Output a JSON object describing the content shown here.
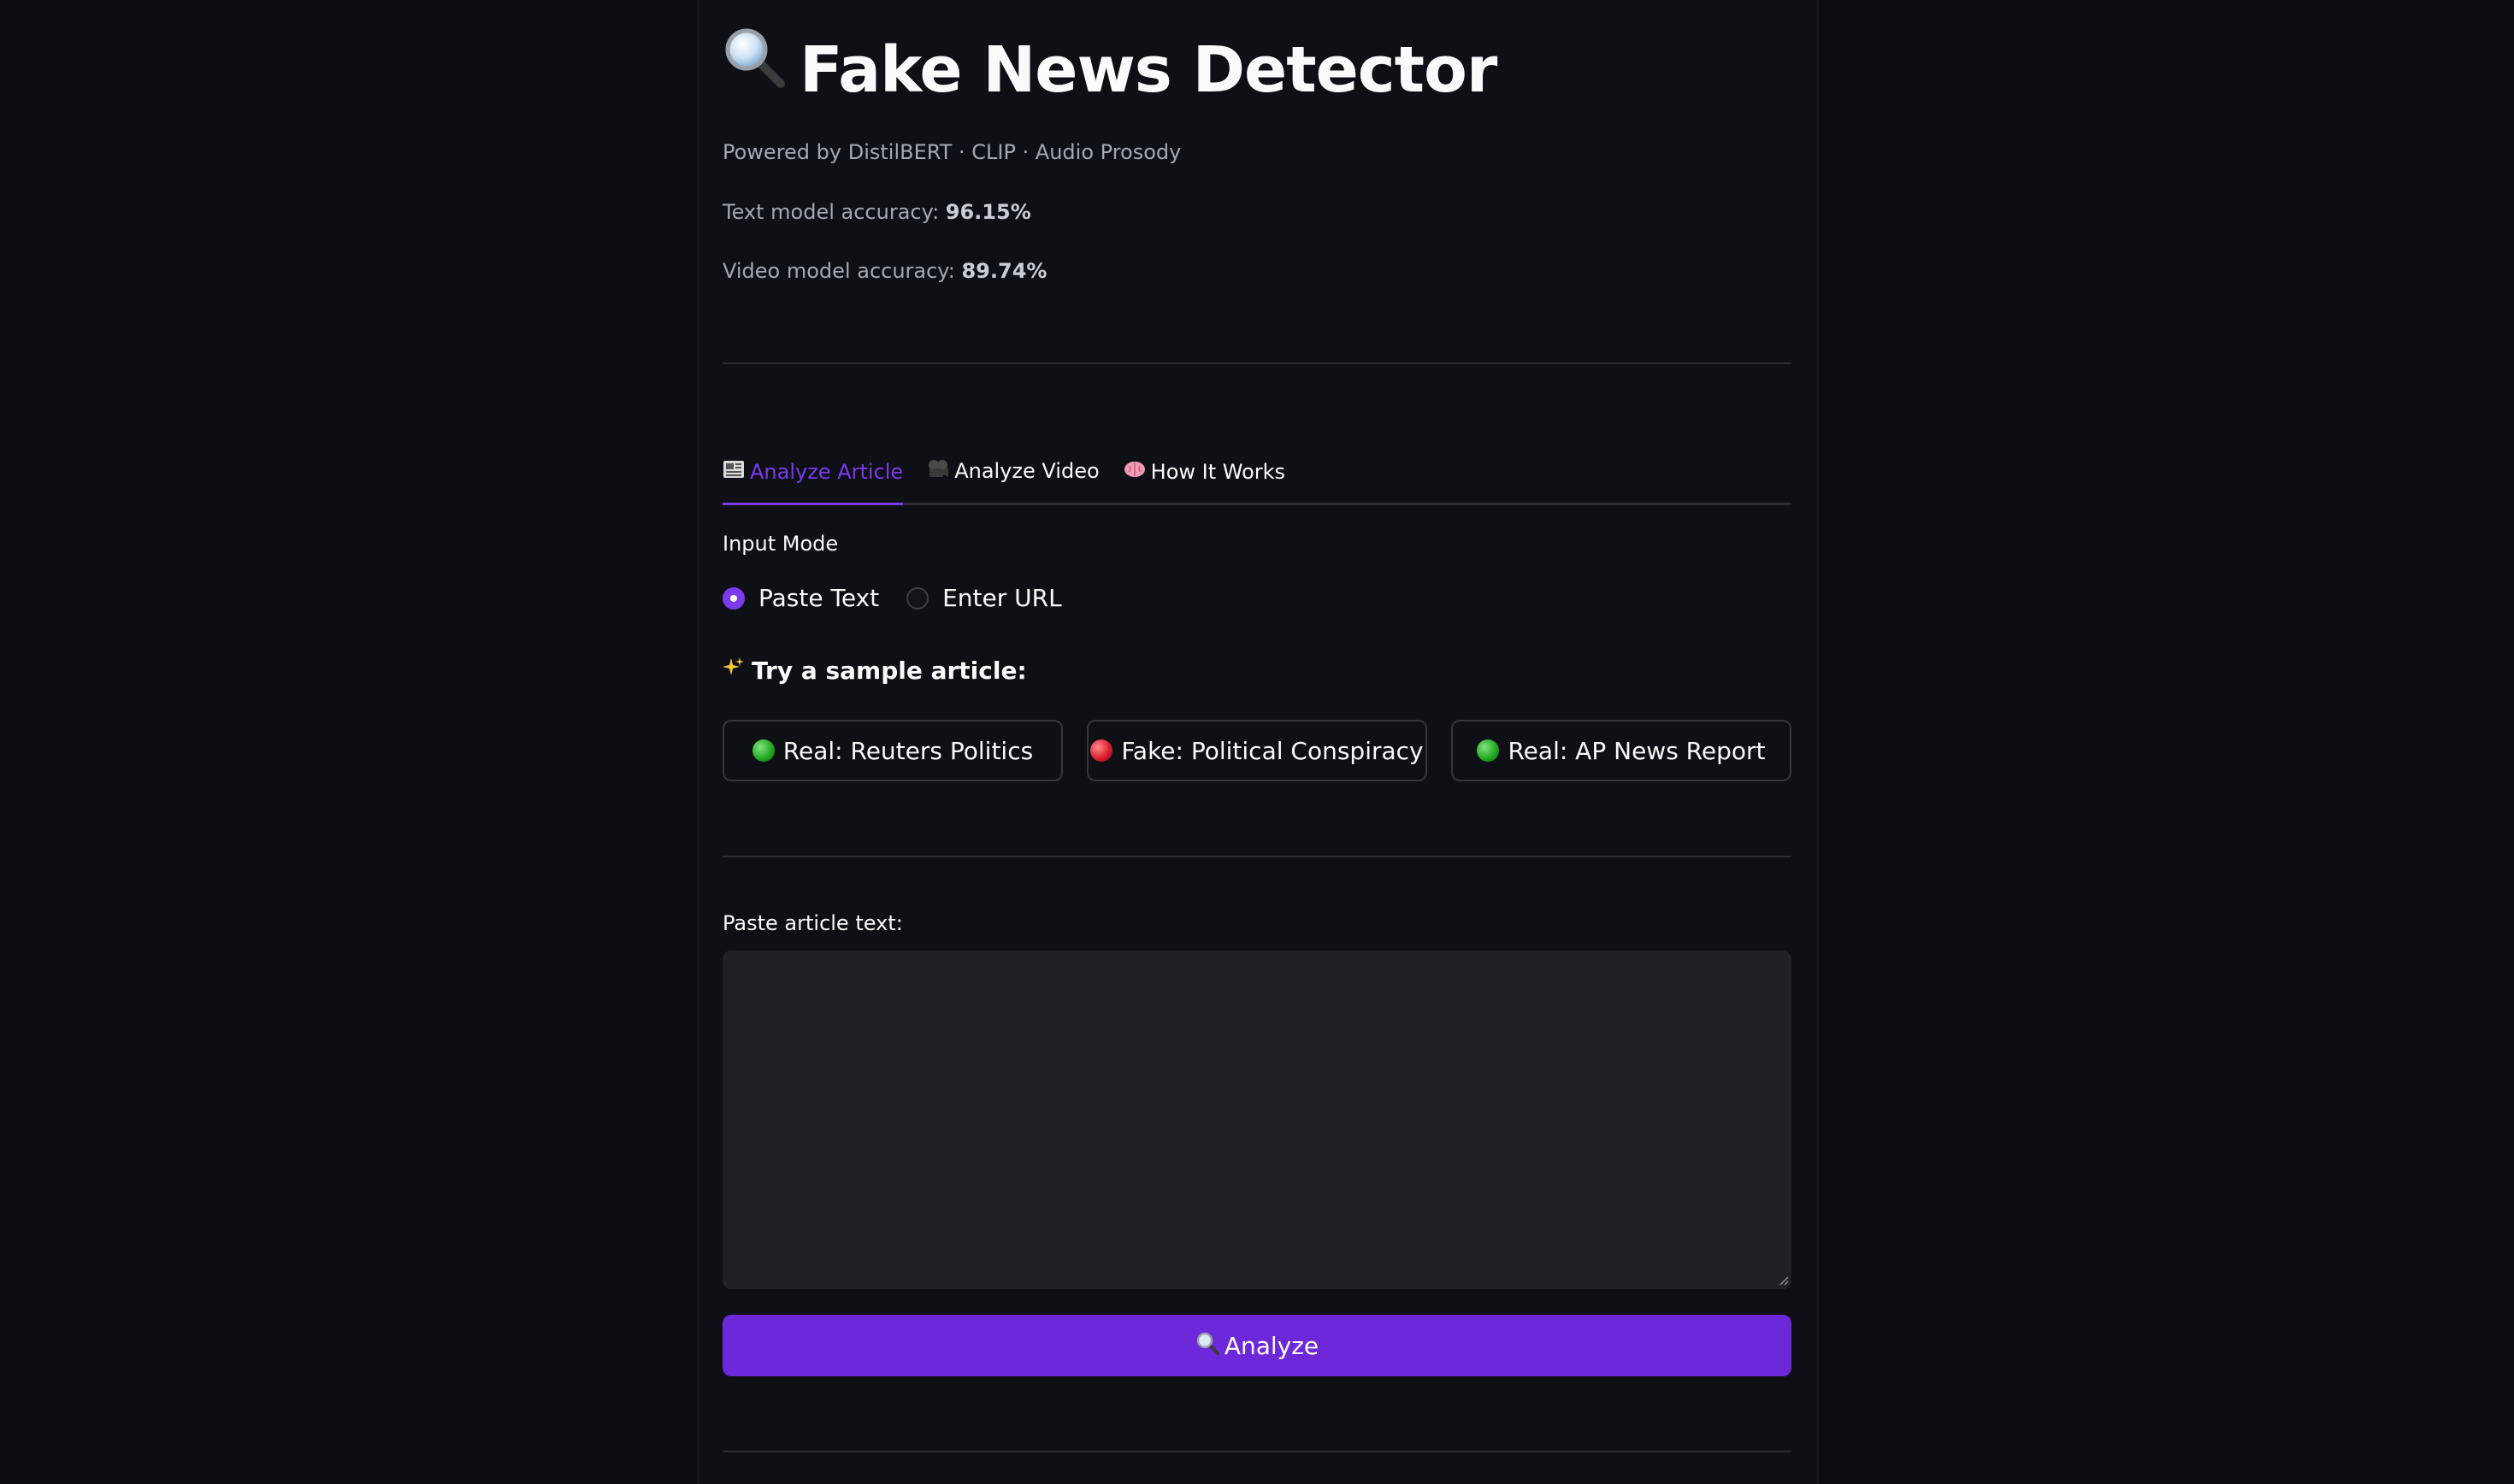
{
  "header": {
    "title_icon": "magnifier-icon",
    "title": "Fake News Detector",
    "powered_by": "Powered by DistilBERT · CLIP · Audio Prosody",
    "text_acc_label": "Text model accuracy: ",
    "text_acc_value": "96.15%",
    "video_acc_label": "Video model accuracy: ",
    "video_acc_value": "89.74%"
  },
  "tabs": [
    {
      "icon": "newspaper-icon",
      "label": "Analyze Article",
      "active": true
    },
    {
      "icon": "film-icon",
      "label": "Analyze Video",
      "active": false
    },
    {
      "icon": "brain-icon",
      "label": "How It Works",
      "active": false
    }
  ],
  "input_mode": {
    "label": "Input Mode",
    "options": [
      {
        "label": "Paste Text",
        "selected": true
      },
      {
        "label": "Enter URL",
        "selected": false
      }
    ]
  },
  "samples": {
    "heading_icon": "sparkles-icon",
    "heading": "Try a sample article:",
    "buttons": [
      {
        "label": "Real: Reuters Politics",
        "dot_color": "#1fa51f"
      },
      {
        "label": "Fake: Political Conspiracy",
        "dot_color": "#d6182a"
      },
      {
        "label": "Real: AP News Report",
        "dot_color": "#1fa51f"
      }
    ]
  },
  "article": {
    "label": "Paste article text:",
    "value": ""
  },
  "analyze_button": {
    "icon": "magnifier-icon",
    "label": "Analyze"
  },
  "colors": {
    "accent": "#7c3aed",
    "button": "#6d28d9",
    "background": "#0e1015"
  }
}
